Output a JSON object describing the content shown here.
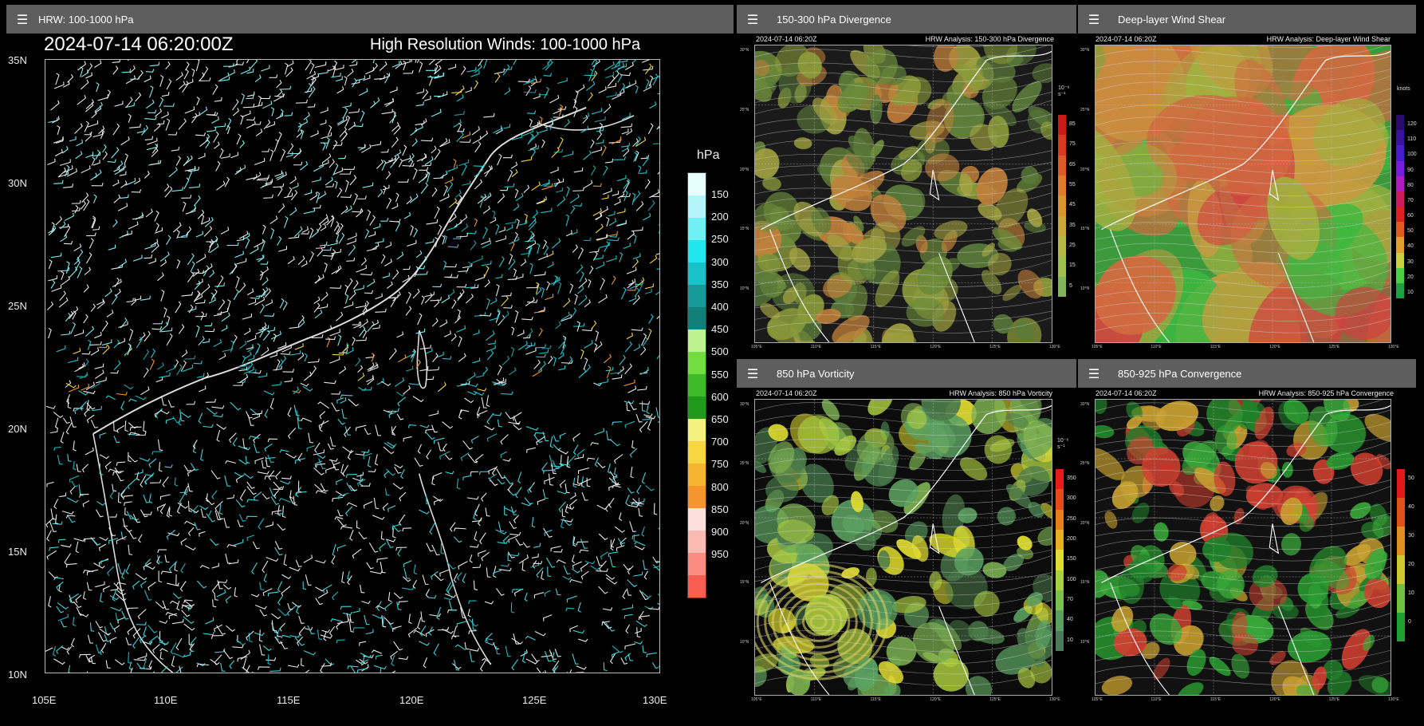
{
  "main": {
    "header_title": "HRW: 100-1000 hPa",
    "timestamp": "2024-07-14 06:20:00Z",
    "title": "High Resolution Winds: 100-1000 hPa",
    "lat_labels": [
      "35N",
      "30N",
      "25N",
      "20N",
      "15N",
      "10N"
    ],
    "lon_labels": [
      "105E",
      "110E",
      "115E",
      "120E",
      "125E",
      "130E"
    ],
    "legend": {
      "title": "hPa",
      "levels": [
        "150",
        "200",
        "250",
        "300",
        "350",
        "400",
        "450",
        "500",
        "550",
        "600",
        "650",
        "700",
        "750",
        "800",
        "850",
        "900",
        "950"
      ],
      "colors": [
        "#e6ffff",
        "#b3f5f8",
        "#6ff0f4",
        "#22e6ee",
        "#19c2c8",
        "#159a97",
        "#127f78",
        "#bdf291",
        "#72dd3f",
        "#3cba27",
        "#1f9a1c",
        "#f4f07d",
        "#f7d63f",
        "#f6b52e",
        "#f4962c",
        "#fde0dc",
        "#fbbab2",
        "#fa8c82",
        "#f85d52"
      ]
    }
  },
  "panels": {
    "divergence": {
      "header_title": "150-300 hPa Divergence",
      "timestamp": "2024-07-14 06:20Z",
      "title": "HRW Analysis: 150-300 hPa Divergence",
      "unit": "10⁻⁶ s⁻¹",
      "labels": [
        "85",
        "75",
        "65",
        "55",
        "45",
        "35",
        "25",
        "15",
        "5"
      ],
      "colors": [
        "#cc1a1a",
        "#d73a20",
        "#dd5a26",
        "#e07a2c",
        "#d9952f",
        "#c9a83a",
        "#b5b746",
        "#9fbf4e",
        "#82b55a"
      ]
    },
    "shear": {
      "header_title": "Deep-layer Wind Shear",
      "timestamp": "2024-07-14 06:20Z",
      "title": "HRW Analysis: Deep-layer Wind Shear",
      "unit": "knots",
      "labels": [
        "120",
        "110",
        "100",
        "90",
        "80",
        "70",
        "60",
        "50",
        "40",
        "30",
        "20",
        "10"
      ],
      "colors": [
        "#2a0c6c",
        "#3a14a0",
        "#4a1cd0",
        "#7a1ce0",
        "#b01cc0",
        "#d01a60",
        "#e02020",
        "#e05a20",
        "#e0a030",
        "#c8d040",
        "#4ad040",
        "#20a040"
      ]
    },
    "vorticity": {
      "header_title": "850 hPa Vorticity",
      "timestamp": "2024-07-14 06:20Z",
      "title": "HRW Analysis: 850 hPa Vorticity",
      "unit": "10⁻⁶ s⁻¹",
      "labels": [
        "350",
        "300",
        "250",
        "200",
        "150",
        "100",
        "70",
        "40",
        "10"
      ],
      "colors": [
        "#e81a1a",
        "#e84a1a",
        "#e8801a",
        "#e8b020",
        "#e0dc30",
        "#a8d040",
        "#7cc050",
        "#5aa060",
        "#4a7a5a"
      ]
    },
    "convergence": {
      "header_title": "850-925 hPa Convergence",
      "timestamp": "2024-07-14 06:20Z",
      "title": "HRW Analysis: 850-925 hPa Convergence",
      "unit": "",
      "labels": [
        "50",
        "40",
        "30",
        "20",
        "10",
        "0"
      ],
      "colors": [
        "#e01a1a",
        "#e0501a",
        "#e09020",
        "#d0c830",
        "#70c040",
        "#20a030"
      ]
    }
  },
  "small_lon_labels": [
    "105°E",
    "110°E",
    "115°E",
    "120°E",
    "125°E",
    "130°E"
  ],
  "small_lat_labels": [
    "30°N",
    "25°N",
    "20°N",
    "15°N",
    "10°N"
  ]
}
